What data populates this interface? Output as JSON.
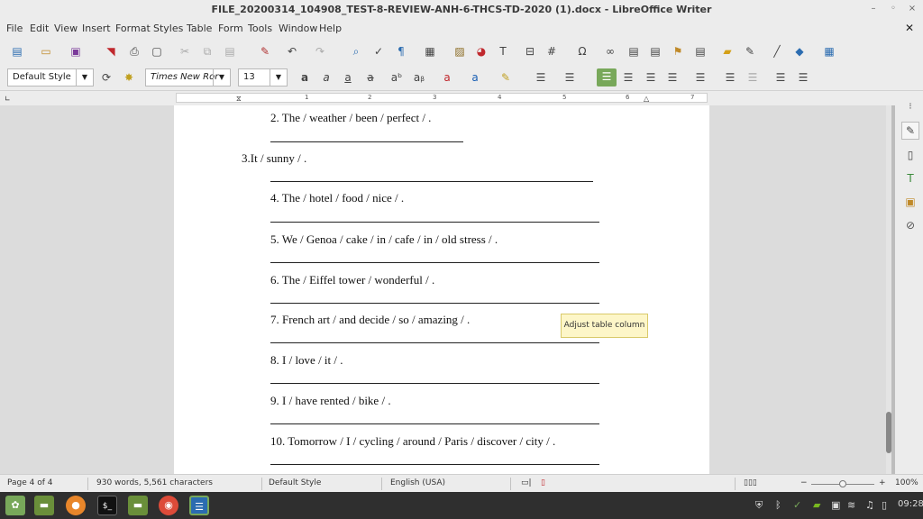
{
  "window": {
    "title": "FILE_20200314_104908_TEST-8-REVIEW-ANH-6-THCS-TD-2020 (1).docx - LibreOffice Writer"
  },
  "menu": [
    "File",
    "Edit",
    "View",
    "Insert",
    "Format",
    "Styles",
    "Table",
    "Form",
    "Tools",
    "Window",
    "Help"
  ],
  "formatting": {
    "paragraph_style": "Default Style",
    "font_name": "Times New Ror",
    "font_size": "13"
  },
  "ruler_numbers": [
    "1",
    "2",
    "3",
    "4",
    "5",
    "6",
    "7"
  ],
  "document": {
    "lines": [
      "2. The / weather / been / perfect / .",
      "3.It / sunny / .",
      "4. The / hotel / food / nice / .",
      "5. We / Genoa / cake / in / cafe / in / old stress / .",
      "6. The / Eiffel tower / wonderful / .",
      "7. French art / and decide / so / amazing / .",
      "8. I / love / it / .",
      "9. I / have rented / bike / .",
      "10. Tomorrow /  I / cycling / around / Paris / discover / city / ."
    ]
  },
  "tooltip": "Adjust table column",
  "status": {
    "page": "Page 4 of 4",
    "words": "930 words, 5,561 characters",
    "style": "Default Style",
    "language": "English (USA)",
    "zoom": "100%"
  },
  "zoom_fraction": 0.5,
  "clock": "09:28",
  "accent": "#78a85a"
}
